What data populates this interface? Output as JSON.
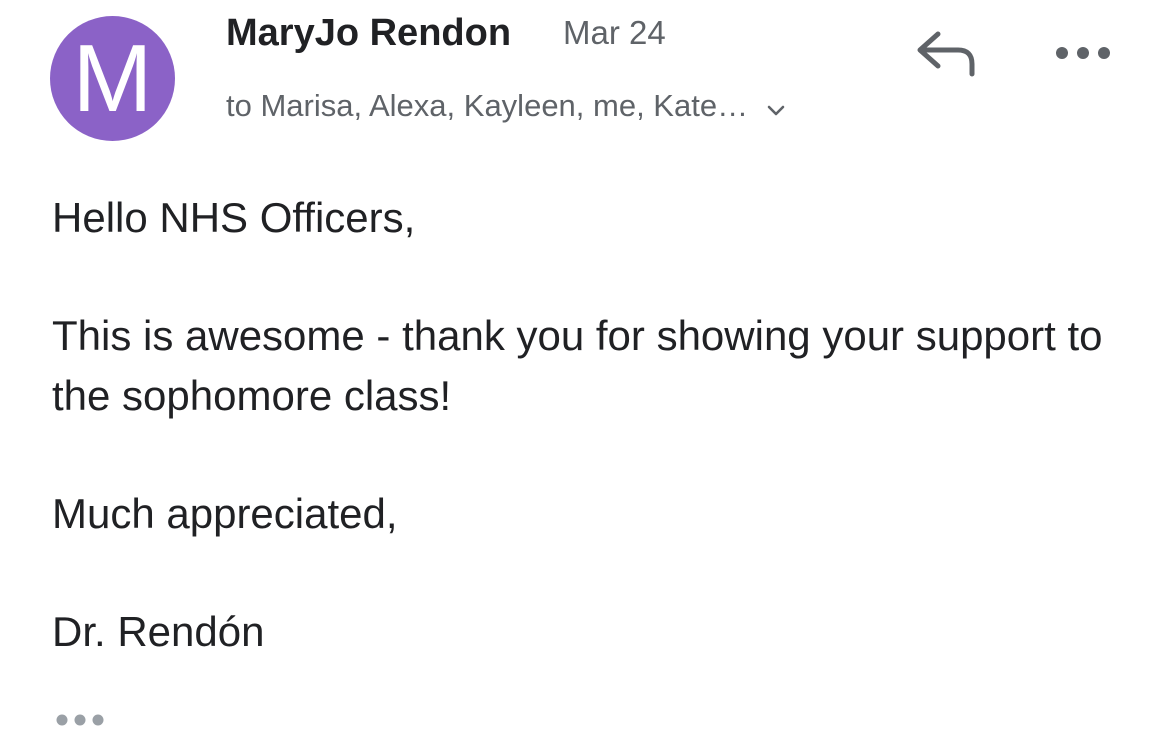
{
  "email": {
    "sender": {
      "initial": "M",
      "name": "MaryJo Rendon",
      "avatar_color": "#8b62c7"
    },
    "date": "Mar 24",
    "recipients": "to Marisa, Alexa, Kayleen, me, Kate…",
    "body": {
      "greeting": "Hello NHS Officers,",
      "message": "This is awesome - thank you for showing your support to the sophomore class!",
      "closing": "Much appreciated,",
      "signature": "Dr. Rendón"
    }
  },
  "icons": {
    "reply": "reply-arrow-icon",
    "more": "more-horizontal-icon",
    "expand_recipients": "chevron-down-icon",
    "show_quoted": "ellipsis-icon"
  },
  "colors": {
    "text_primary": "#202124",
    "text_secondary": "#5f6368",
    "icon_gray": "#5f6368",
    "quoted_dots": "#9aa0a6"
  }
}
